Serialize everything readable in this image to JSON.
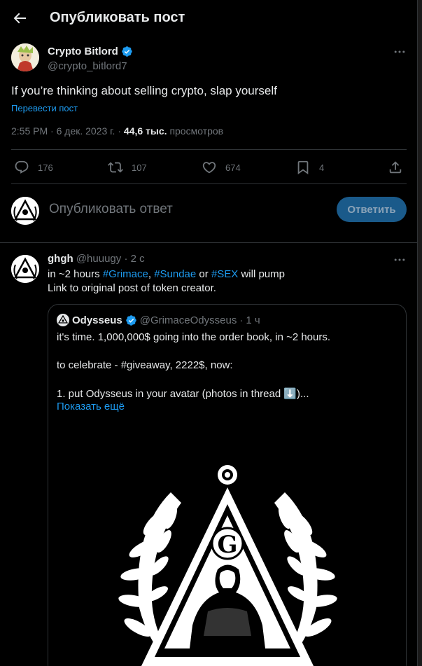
{
  "header": {
    "title": "Опубликовать пост"
  },
  "post": {
    "author_name": "Crypto Bitlord",
    "author_handle": "@crypto_bitlord7",
    "text": "If you’re thinking about selling crypto, slap yourself",
    "translate_label": "Перевести пост",
    "time": "2:55 PM",
    "date": "6 дек. 2023 г.",
    "views_count": "44,6 тыс.",
    "views_label": "просмотров",
    "replies": "176",
    "reposts": "107",
    "likes": "674",
    "bookmarks": "4"
  },
  "reply_box": {
    "placeholder": "Опубликовать ответ",
    "button_label": "Ответить"
  },
  "reply_tweet": {
    "name": "ghgh",
    "handle": "@huuugy",
    "time": "2 с",
    "line1_prefix": "in ~2 hours ",
    "tag1": "#Grimace",
    "sep1": ", ",
    "tag2": "#Sundae",
    "sep2": " or ",
    "tag3": "#SEX",
    "line1_suffix": " will pump",
    "line2": "Link to original post of token creator."
  },
  "quoted": {
    "name": "Odysseus",
    "handle": "@GrimaceOdysseus",
    "time": "1 ч",
    "line1": "it's time. 1,000,000$ going into the order book, in ~2 hours.",
    "line2": "to celebrate - #giveaway, 2222$, now:",
    "line3": "1. put Odysseus in your avatar (photos in thread ⬇️)...",
    "show_more": "Показать ещё",
    "image_letter": "G"
  },
  "colors": {
    "accent": "#1d9bf0",
    "muted": "#71767b",
    "text": "#e7e9ea",
    "border": "#2f3336",
    "background": "#000000"
  }
}
